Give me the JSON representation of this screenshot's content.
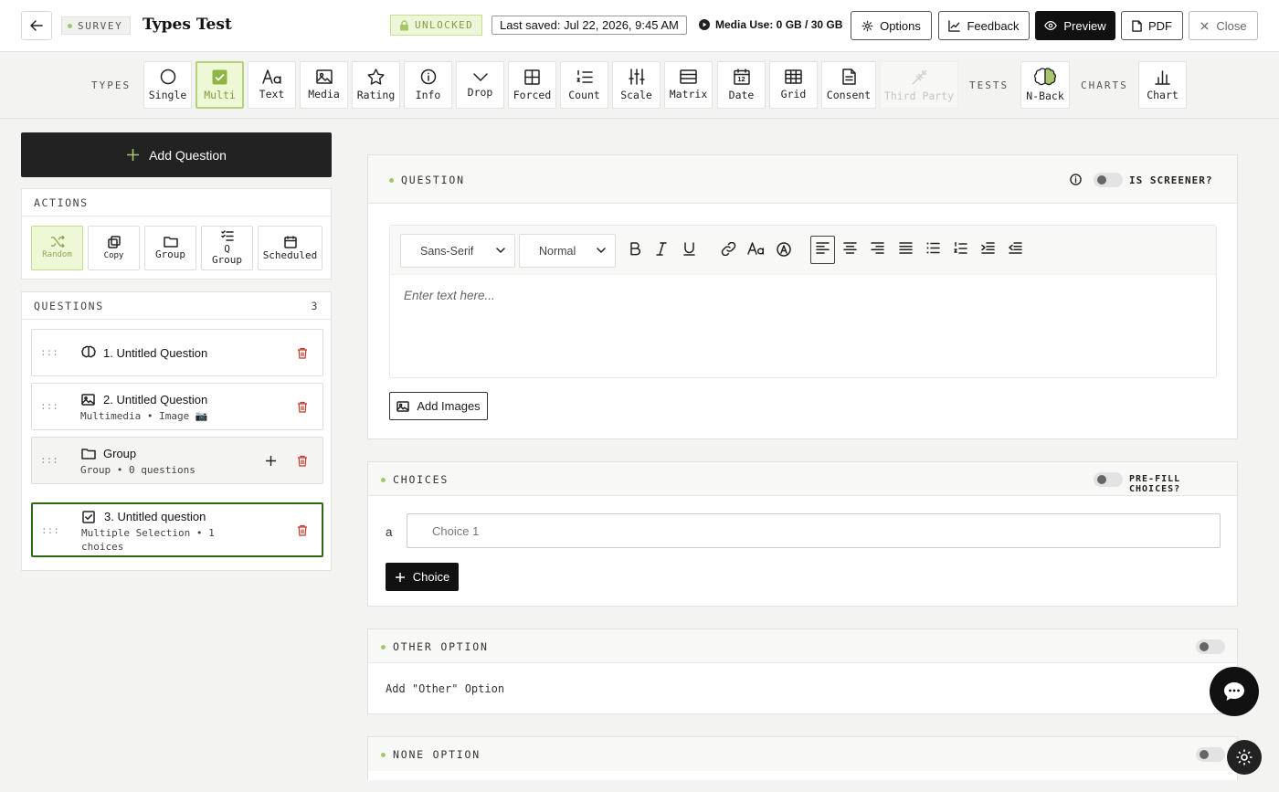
{
  "header": {
    "survey_badge": "SURVEY",
    "title": "Types Test",
    "status": "UNLOCKED",
    "last_saved": "Last saved: Jul 22, 2026, 9:45 AM",
    "media_use": "Media Use: 0 GB / 30 GB",
    "buttons": {
      "options": "Options",
      "feedback": "Feedback",
      "preview": "Preview",
      "pdf": "PDF",
      "close": "Close"
    }
  },
  "typesbar": {
    "types_label": "TYPES",
    "tests_label": "TESTS",
    "charts_label": "CHARTS",
    "types": [
      "Single",
      "Multi",
      "Text",
      "Media",
      "Rating",
      "Info",
      "Drop",
      "Forced",
      "Count",
      "Scale",
      "Matrix",
      "Date",
      "Grid",
      "Consent",
      "Third Party"
    ],
    "active_type": "Multi",
    "disabled_type": "Third Party",
    "tests": [
      "N-Back"
    ],
    "charts": [
      "Chart"
    ],
    "date_icon_number": "12"
  },
  "left": {
    "add_question": "Add Question",
    "actions_label": "ACTIONS",
    "actions": [
      "Random",
      "Copy",
      "Group",
      "Q\nGroup",
      "Scheduled"
    ],
    "questions_label": "QUESTIONS",
    "questions_count": "3",
    "questions": [
      {
        "title": "1. Untitled Question",
        "subtitle": ""
      },
      {
        "title": "2. Untitled Question",
        "subtitle": "Multimedia • Image 📷"
      },
      {
        "title": "Group",
        "subtitle": "Group • 0 questions"
      },
      {
        "title": "3. Untitled question",
        "subtitle": "Multiple Selection • 1 choices"
      }
    ]
  },
  "question_card": {
    "label": "QUESTION",
    "screener_label": "IS SCREENER?",
    "font_select": "Sans-Serif",
    "size_select": "Normal",
    "placeholder": "Enter text here...",
    "add_images": "Add Images"
  },
  "choices_card": {
    "label": "CHOICES",
    "prefill_label": "PRE-FILL CHOICES?",
    "choice_letter": "a",
    "choice_placeholder": "Choice 1",
    "add_choice": "Choice"
  },
  "other_card": {
    "label": "OTHER OPTION",
    "text": "Add \"Other\" Option"
  },
  "none_card": {
    "label": "NONE OPTION"
  },
  "colors": {
    "accent_green": "#a5c66b",
    "active_bg": "#eef7d6",
    "selected_border": "#2c6b14",
    "danger": "#c0392b",
    "dark": "#111111"
  }
}
